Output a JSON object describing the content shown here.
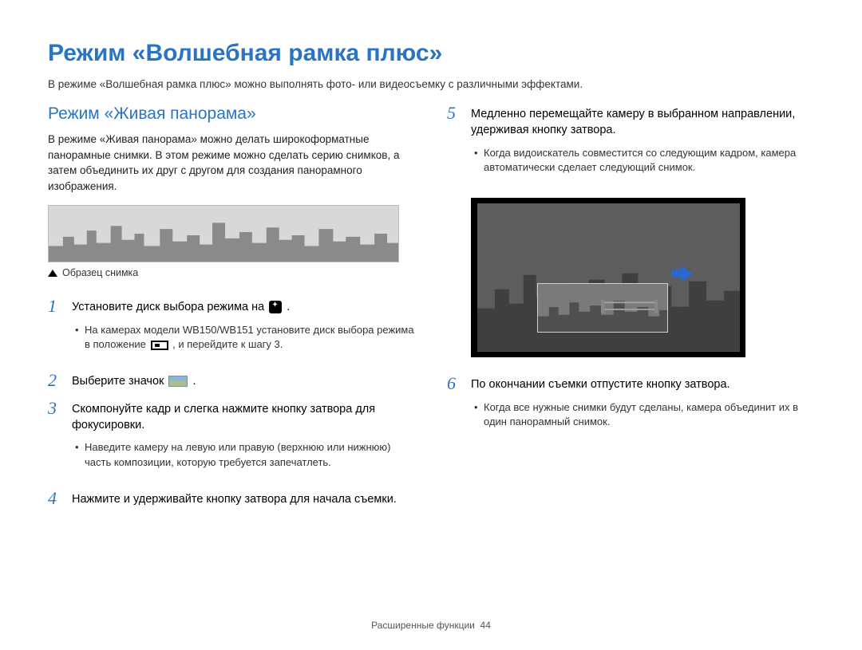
{
  "title": "Режим «Волшебная рамка плюс»",
  "intro": "В режиме «Волшебная рамка плюс» можно выполнять фото- или видеосъемку с различными эффектами.",
  "section_title": "Режим «Живая панорама»",
  "section_intro": "В режиме «Живая панорама» можно делать широкоформатные панорамные снимки. В этом режиме можно сделать серию снимков, а затем объединить их друг с другом для создания панорамного изображения.",
  "sample_caption": "Образец снимка",
  "steps": {
    "s1_pre": "Установите диск выбора режима на ",
    "s1_post": " .",
    "s1_sub_pre": "На камерах модели WB150/WB151 установите диск выбора режима в положение ",
    "s1_sub_post": " , и перейдите к шагу 3.",
    "s2_pre": "Выберите значок ",
    "s2_post": " .",
    "s3": "Скомпонуйте кадр и слегка нажмите кнопку затвора для фокусировки.",
    "s3_sub": "Наведите камеру на левую или правую (верхнюю или нижнюю) часть композиции, которую требуется запечатлеть.",
    "s4": "Нажмите и удерживайте кнопку затвора для начала съемки.",
    "s5": "Медленно перемещайте камеру в выбранном направлении, удерживая кнопку затвора.",
    "s5_sub": "Когда видоискатель совместится со следующим кадром, камера автоматически сделает следующий снимок.",
    "s6": "По окончании съемки отпустите кнопку затвора.",
    "s6_sub": "Когда все нужные снимки будут сделаны, камера объединит их в один панорамный снимок."
  },
  "numbers": {
    "n1": "1",
    "n2": "2",
    "n3": "3",
    "n4": "4",
    "n5": "5",
    "n6": "6"
  },
  "footer_label": "Расширенные функции",
  "footer_page": "44"
}
